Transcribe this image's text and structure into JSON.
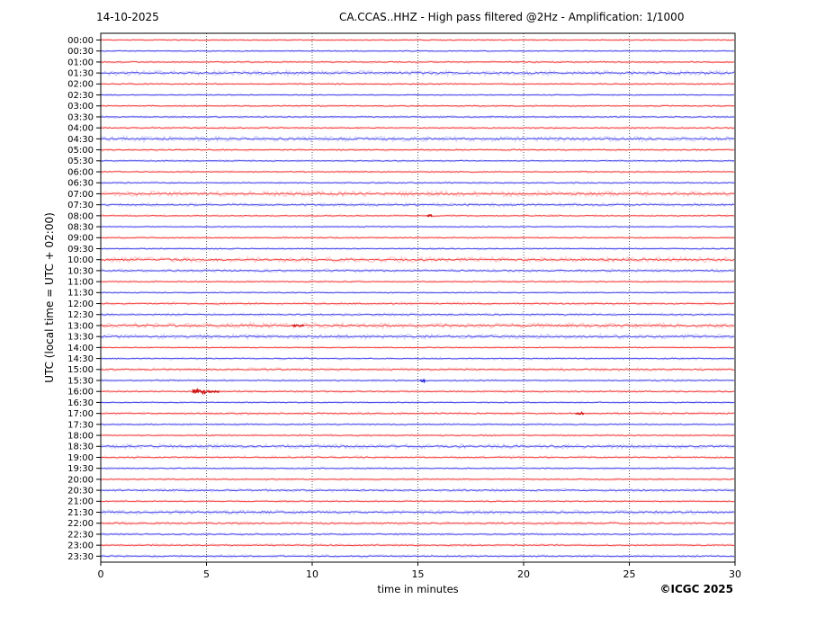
{
  "header": {
    "date": "14-10-2025",
    "title": "CA.CCAS..HHZ - High pass filtered @2Hz - Amplification: 1/1000"
  },
  "y_axis": {
    "label": "UTC (local time = UTC + 02:00)"
  },
  "x_axis": {
    "label": "time in minutes",
    "ticks": [
      0,
      5,
      10,
      15,
      20,
      25,
      30
    ],
    "range": [
      0,
      30
    ]
  },
  "footer": {
    "copyright": "©ICGC 2025"
  },
  "chart_data": {
    "type": "line",
    "subtype": "helicorder-seismogram",
    "minutes_per_line": 30,
    "grid": "vertical-dotted-every-5-min",
    "colors": {
      "red": {
        "main": "#f23b3b",
        "halo": "#ffb0b0",
        "event": "#cc0e0e"
      },
      "blue": {
        "main": "#4343e8",
        "halo": "#b4b4fb",
        "event": "#1d1dd8"
      }
    },
    "rows": [
      {
        "label": "00:00",
        "color": "red",
        "noise": 0.6,
        "events": []
      },
      {
        "label": "00:30",
        "color": "blue",
        "noise": 0.6,
        "events": []
      },
      {
        "label": "01:00",
        "color": "red",
        "noise": 0.7,
        "events": []
      },
      {
        "label": "01:30",
        "color": "blue",
        "noise": 1.5,
        "events": []
      },
      {
        "label": "02:00",
        "color": "red",
        "noise": 0.7,
        "events": []
      },
      {
        "label": "02:30",
        "color": "blue",
        "noise": 0.6,
        "events": []
      },
      {
        "label": "03:00",
        "color": "red",
        "noise": 0.7,
        "events": []
      },
      {
        "label": "03:30",
        "color": "blue",
        "noise": 0.7,
        "events": []
      },
      {
        "label": "04:00",
        "color": "red",
        "noise": 0.8,
        "events": []
      },
      {
        "label": "04:30",
        "color": "blue",
        "noise": 1.5,
        "events": []
      },
      {
        "label": "05:00",
        "color": "red",
        "noise": 0.8,
        "events": []
      },
      {
        "label": "05:30",
        "color": "blue",
        "noise": 0.6,
        "events": []
      },
      {
        "label": "06:00",
        "color": "red",
        "noise": 0.7,
        "events": []
      },
      {
        "label": "06:30",
        "color": "blue",
        "noise": 0.7,
        "events": []
      },
      {
        "label": "07:00",
        "color": "red",
        "noise": 1.6,
        "events": []
      },
      {
        "label": "07:30",
        "color": "blue",
        "noise": 1.1,
        "events": []
      },
      {
        "label": "08:00",
        "color": "red",
        "noise": 0.7,
        "events": [
          {
            "start_min": 15.45,
            "end_min": 15.68,
            "amp": 1.3
          }
        ]
      },
      {
        "label": "08:30",
        "color": "blue",
        "noise": 0.6,
        "events": []
      },
      {
        "label": "09:00",
        "color": "red",
        "noise": 0.7,
        "events": []
      },
      {
        "label": "09:30",
        "color": "blue",
        "noise": 0.7,
        "events": []
      },
      {
        "label": "10:00",
        "color": "red",
        "noise": 1.6,
        "events": []
      },
      {
        "label": "10:30",
        "color": "blue",
        "noise": 1.0,
        "events": []
      },
      {
        "label": "11:00",
        "color": "red",
        "noise": 0.7,
        "events": []
      },
      {
        "label": "11:30",
        "color": "blue",
        "noise": 0.6,
        "events": []
      },
      {
        "label": "12:00",
        "color": "red",
        "noise": 0.9,
        "events": []
      },
      {
        "label": "12:30",
        "color": "blue",
        "noise": 0.9,
        "events": []
      },
      {
        "label": "13:00",
        "color": "red",
        "noise": 1.6,
        "events": [
          {
            "start_min": 9.05,
            "end_min": 9.6,
            "amp": 0.9
          }
        ]
      },
      {
        "label": "13:30",
        "color": "blue",
        "noise": 1.4,
        "events": []
      },
      {
        "label": "14:00",
        "color": "red",
        "noise": 0.6,
        "events": []
      },
      {
        "label": "14:30",
        "color": "blue",
        "noise": 0.7,
        "events": []
      },
      {
        "label": "15:00",
        "color": "red",
        "noise": 1.0,
        "events": []
      },
      {
        "label": "15:30",
        "color": "blue",
        "noise": 0.7,
        "events": [
          {
            "start_min": 15.1,
            "end_min": 15.35,
            "amp": 1.8
          }
        ]
      },
      {
        "label": "16:00",
        "color": "red",
        "noise": 0.8,
        "events": [
          {
            "start_min": 4.35,
            "end_min": 5.0,
            "amp": 2.4
          },
          {
            "start_min": 5.0,
            "end_min": 5.6,
            "amp": 1.1
          }
        ]
      },
      {
        "label": "16:30",
        "color": "blue",
        "noise": 0.6,
        "events": []
      },
      {
        "label": "17:00",
        "color": "red",
        "noise": 0.9,
        "events": [
          {
            "start_min": 22.45,
            "end_min": 22.85,
            "amp": 1.4
          }
        ]
      },
      {
        "label": "17:30",
        "color": "blue",
        "noise": 0.7,
        "events": []
      },
      {
        "label": "18:00",
        "color": "red",
        "noise": 0.7,
        "events": []
      },
      {
        "label": "18:30",
        "color": "blue",
        "noise": 1.4,
        "events": []
      },
      {
        "label": "19:00",
        "color": "red",
        "noise": 0.9,
        "events": []
      },
      {
        "label": "19:30",
        "color": "blue",
        "noise": 0.7,
        "events": []
      },
      {
        "label": "20:00",
        "color": "red",
        "noise": 0.7,
        "events": []
      },
      {
        "label": "20:30",
        "color": "blue",
        "noise": 1.0,
        "events": []
      },
      {
        "label": "21:00",
        "color": "red",
        "noise": 0.7,
        "events": []
      },
      {
        "label": "21:30",
        "color": "blue",
        "noise": 1.3,
        "events": []
      },
      {
        "label": "22:00",
        "color": "red",
        "noise": 1.0,
        "events": []
      },
      {
        "label": "22:30",
        "color": "blue",
        "noise": 0.8,
        "events": []
      },
      {
        "label": "23:00",
        "color": "red",
        "noise": 0.8,
        "events": []
      },
      {
        "label": "23:30",
        "color": "blue",
        "noise": 0.9,
        "events": []
      }
    ]
  }
}
